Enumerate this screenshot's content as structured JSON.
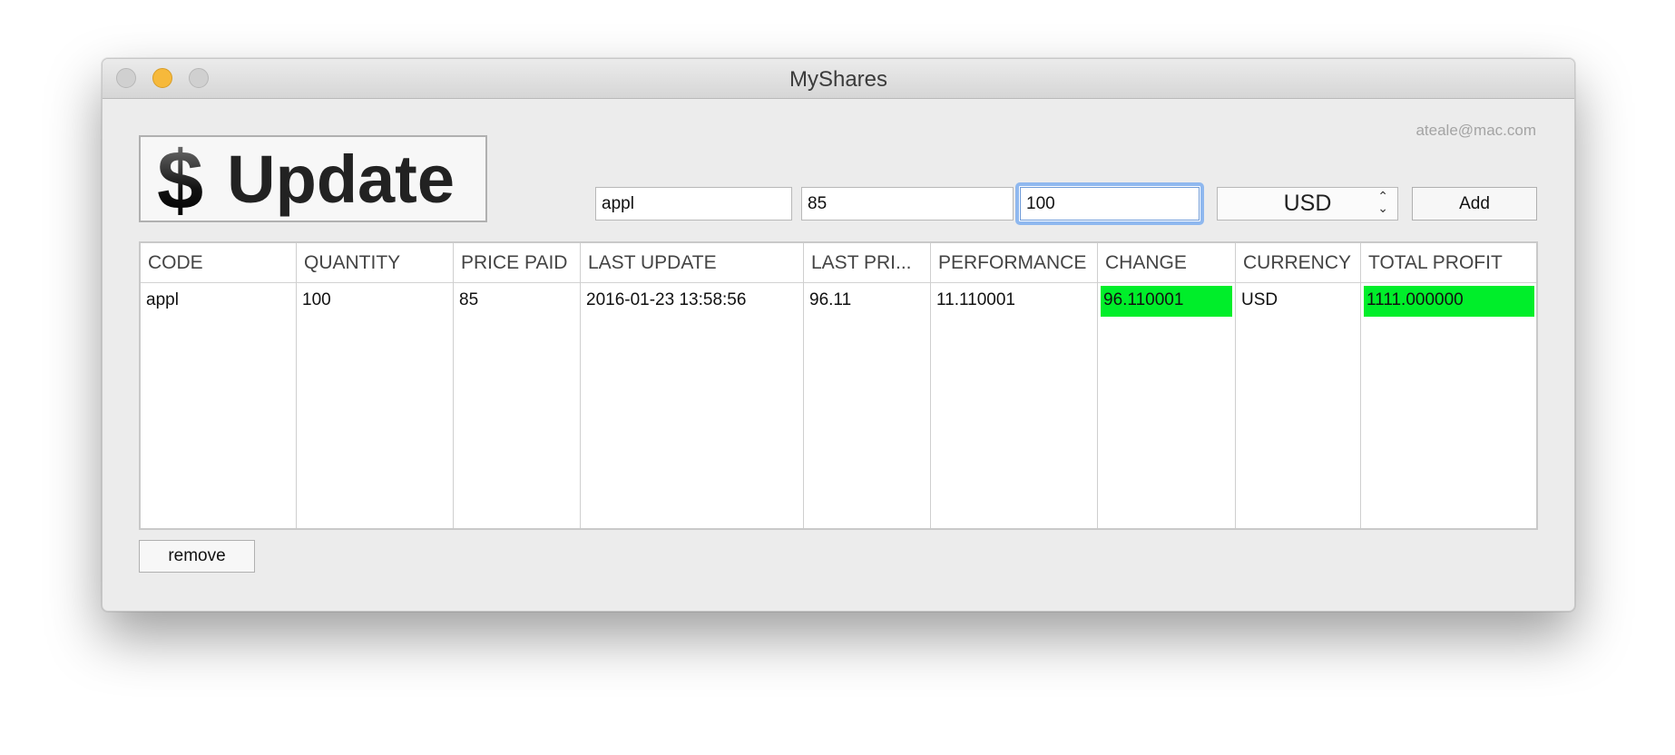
{
  "window": {
    "title": "MyShares",
    "account_email": "ateale@mac.com"
  },
  "toolbar": {
    "update_icon": "dollar-icon",
    "update_label": "Update",
    "code_input_value": "appl",
    "price_input_value": "85",
    "quantity_input_value": "100",
    "currency_selected": "USD",
    "add_label": "Add"
  },
  "table": {
    "columns": [
      "CODE",
      "QUANTITY",
      "PRICE PAID",
      "LAST UPDATE",
      "LAST PRI...",
      "PERFORMANCE",
      "CHANGE",
      "CURRENCY",
      "TOTAL PROFIT"
    ],
    "rows": [
      [
        "appl",
        "100",
        "85",
        "2016-01-23 13:58:56",
        "96.11",
        "11.110001",
        "96.110001",
        "USD",
        "1111.000000"
      ]
    ],
    "highlight_color": "#00ee2a"
  },
  "footer": {
    "remove_label": "remove"
  }
}
